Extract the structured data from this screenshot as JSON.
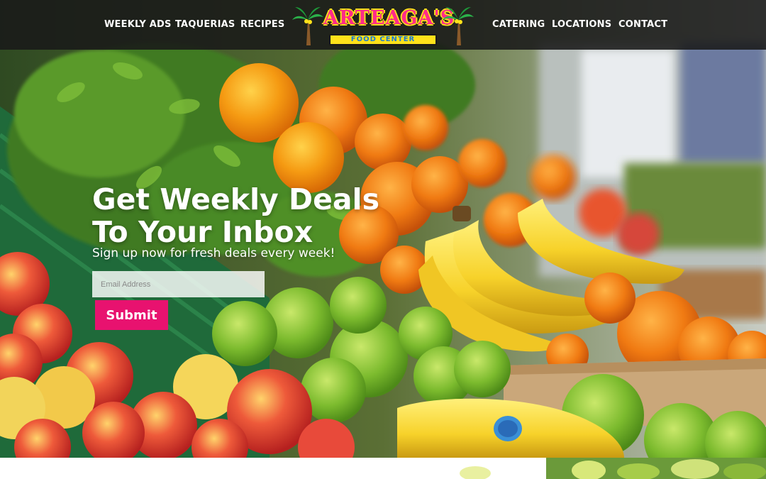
{
  "nav": {
    "left": [
      {
        "label": "WEEKLY ADS"
      },
      {
        "label": "TAQUERIAS"
      },
      {
        "label": "RECIPES"
      }
    ],
    "right": [
      {
        "label": "CATERING"
      },
      {
        "label": "LOCATIONS"
      },
      {
        "label": "CONTACT"
      }
    ]
  },
  "logo": {
    "name": "ARTEAGA'S",
    "tagline": "FOOD CENTER",
    "icon": "palm-tree-icon"
  },
  "hero": {
    "headline_line1": "Get Weekly Deals",
    "headline_line2": "To Your Inbox",
    "subheadline": "Sign up now for fresh deals every week!",
    "email_placeholder": "Email Address",
    "submit_label": "Submit"
  },
  "colors": {
    "accent": "#e8126f",
    "logo_pink": "#ff2a8a",
    "logo_yellow": "#ffe21a",
    "logo_blue": "#1b7bd1",
    "nav_bg": "#191919"
  }
}
